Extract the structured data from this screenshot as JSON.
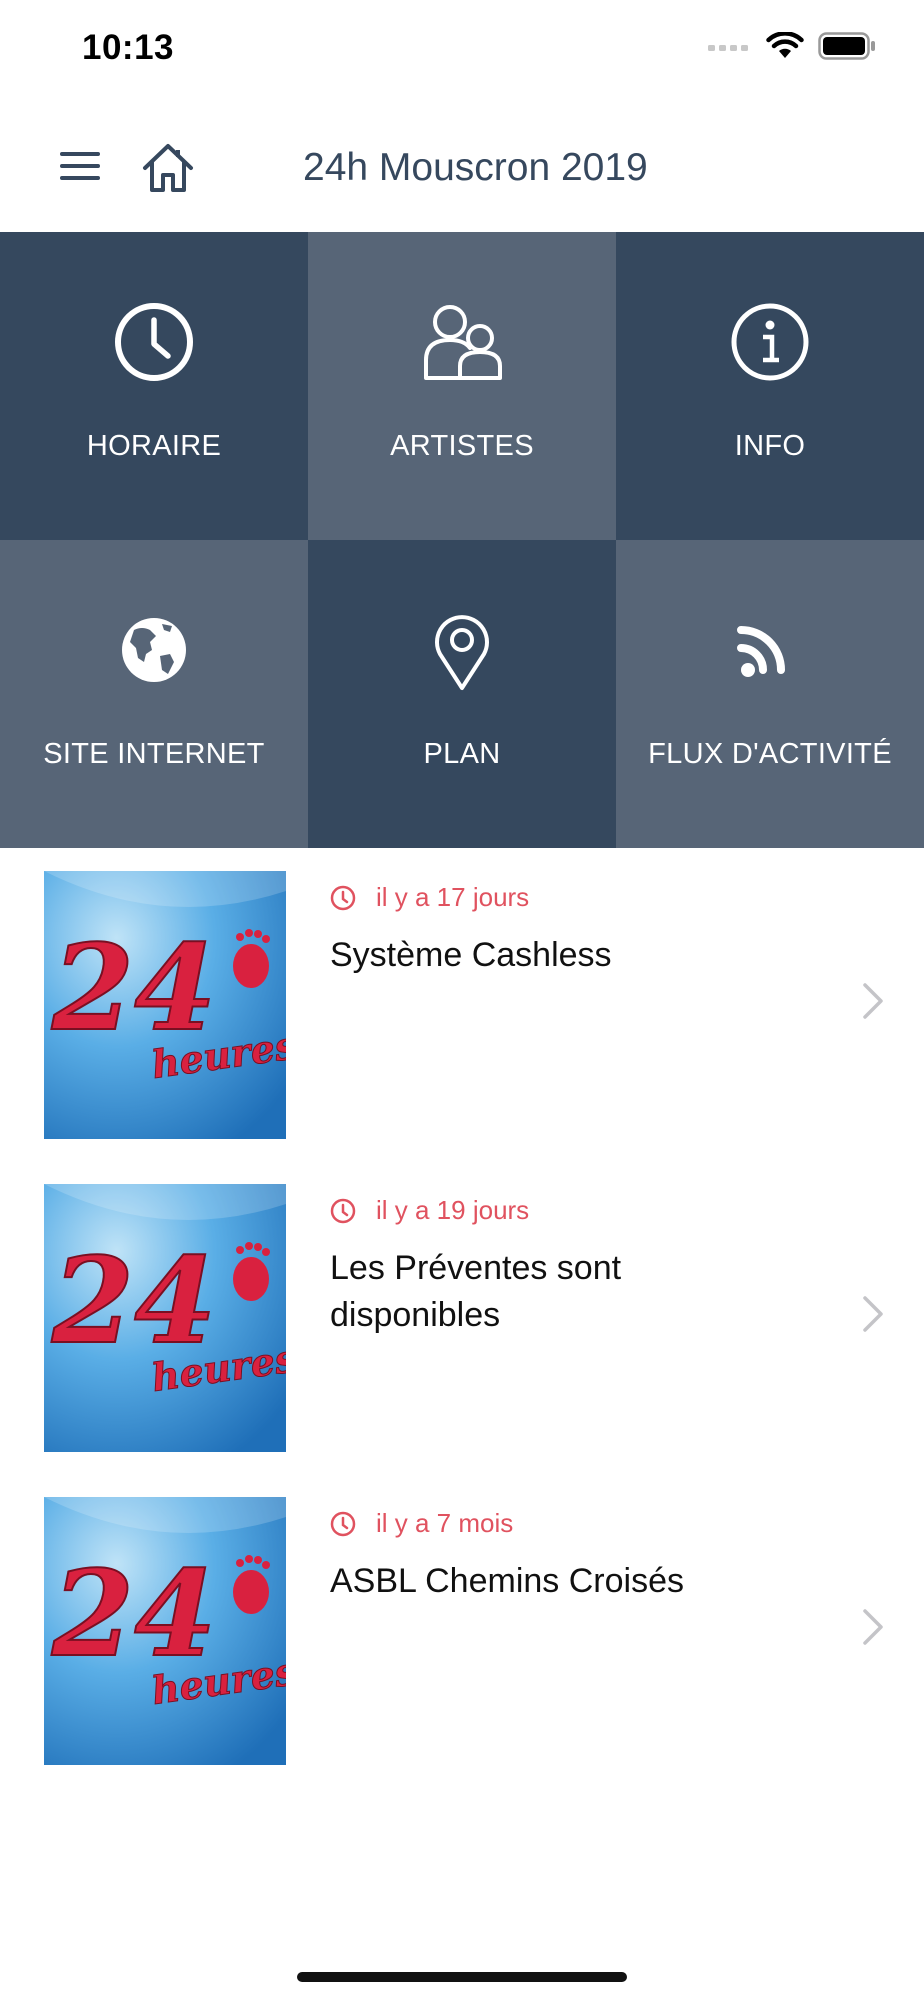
{
  "status_bar": {
    "time": "10:13"
  },
  "nav": {
    "title": "24h Mouscron 2019"
  },
  "colors": {
    "tile_dark": "#35485e",
    "tile_light": "#576577",
    "accent": "#e0525f",
    "title": "#36485e"
  },
  "tiles": [
    {
      "label": "HORAIRE",
      "icon": "clock-icon"
    },
    {
      "label": "ARTISTES",
      "icon": "people-icon"
    },
    {
      "label": "INFO",
      "icon": "info-icon"
    },
    {
      "label": "SITE INTERNET",
      "icon": "globe-icon"
    },
    {
      "label": "PLAN",
      "icon": "map-pin-icon"
    },
    {
      "label": "FLUX D'ACTIVITÉ",
      "icon": "rss-icon"
    }
  ],
  "feed": [
    {
      "time": "il y a 17 jours",
      "title": "Système Cashless",
      "thumb_text": "24",
      "thumb_sub": "heures"
    },
    {
      "time": "il y a 19 jours",
      "title": "Les Préventes sont disponibles",
      "thumb_text": "24",
      "thumb_sub": "heures"
    },
    {
      "time": "il y a 7 mois",
      "title": "ASBL Chemins Croisés",
      "thumb_text": "24",
      "thumb_sub": "heures"
    }
  ]
}
